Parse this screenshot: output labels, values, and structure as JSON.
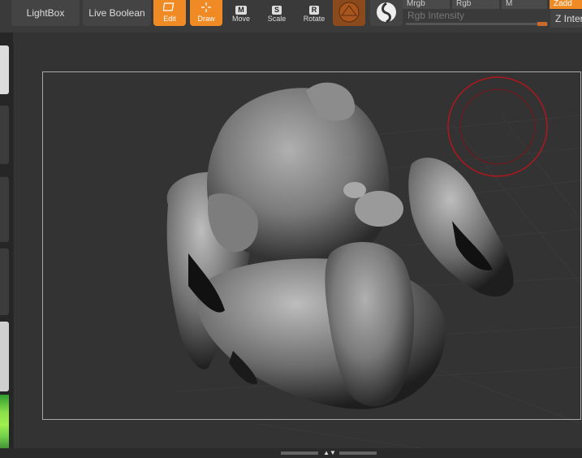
{
  "toolbar": {
    "lightbox_label": "LightBox",
    "live_boolean_label": "Live Boolean",
    "edit_label": "Edit",
    "draw_label": "Draw",
    "move_label": "Move",
    "move_key": "M",
    "scale_label": "Scale",
    "scale_key": "S",
    "rotate_label": "Rotate",
    "rotate_key": "R",
    "material_icon": "sphere-material-icon",
    "texture_icon": "silhouette-material-icon"
  },
  "modes": {
    "mrgb_label": "Mrgb",
    "rgb_label": "Rgb",
    "m_label": "M",
    "zadd_label": "Zadd"
  },
  "sliders": {
    "rgb_intensity_label": "Rgb Intensity",
    "z_intensity_label": "Z Inter"
  },
  "colors": {
    "accent": "#f08a24",
    "brush_cursor": "#b0171d",
    "background": "#333333"
  }
}
